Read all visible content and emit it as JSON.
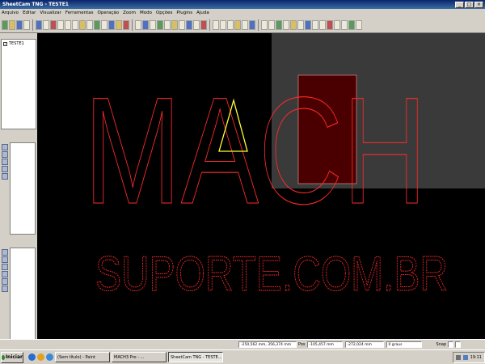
{
  "window": {
    "title": "SheetCam TNG - TESTE1",
    "minimize": "_",
    "maximize": "□",
    "close": "×"
  },
  "menu": [
    "Arquivo",
    "Editar",
    "Visualizar",
    "Ferramentas",
    "Operação",
    "Zoom",
    "Modo",
    "Opções",
    "Plugins",
    "Ajuda"
  ],
  "tree": {
    "item_label": "TESTE1",
    "checked": "✓"
  },
  "canvas": {
    "text_line1": "MACH",
    "text_line2": "SUPORTE.COM.BR",
    "outline_color": "#ff2a2a",
    "highlight_color": "#ffff33",
    "selection_fill": "#4a0000"
  },
  "status": {
    "coords": "-250,562 mm, 356,374 mm",
    "pos_label": "Pos",
    "pos_x": "-105,457 mm",
    "pos_y": "-272,024 mm",
    "angle": "0 graus",
    "snap_label": "Snap"
  },
  "taskbar": {
    "start_label": "Iniciar",
    "tasks": [
      "(Sem título) - Paint",
      "MACH3 Pro - ...",
      "SheetCam TNG - TESTE..."
    ],
    "clock": "19:11"
  },
  "colors": {
    "canvas_bg": "#000000",
    "chrome": "#d4d0c8",
    "title_gradient": "#0a246a"
  }
}
